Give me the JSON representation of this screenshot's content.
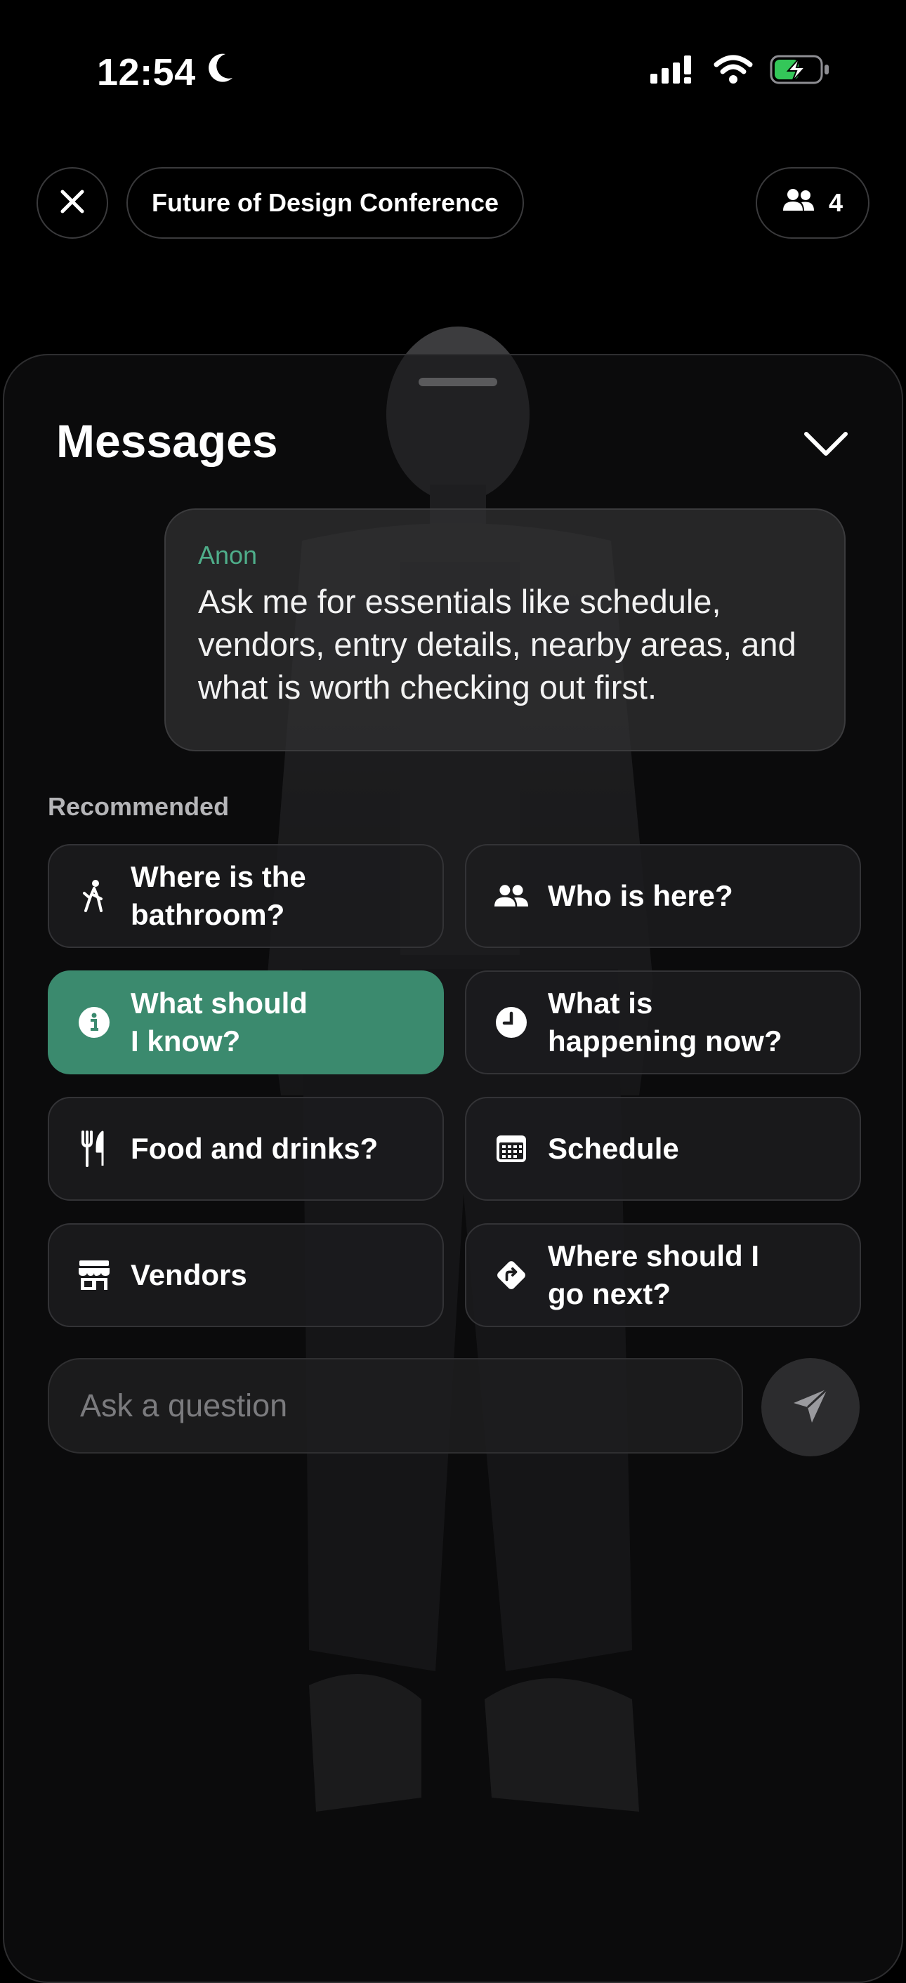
{
  "status_bar": {
    "time": "12:54"
  },
  "header": {
    "title": "Future of Design Conference",
    "people_count": "4"
  },
  "messages": {
    "title": "Messages",
    "bubble": {
      "sender": "Anon",
      "text": "Ask me for essentials like schedule, vendors, entry details, nearby areas, and what is worth checking out first."
    },
    "recommended_label": "Recommended",
    "chips": [
      {
        "label": "Where is the\nbathroom?",
        "icon": "walking-person-icon",
        "active": false
      },
      {
        "label": "Who is here?",
        "icon": "people-icon",
        "active": false
      },
      {
        "label": "What should\nI know?",
        "icon": "info-icon",
        "active": true
      },
      {
        "label": "What is\nhappening now?",
        "icon": "clock-icon",
        "active": false
      },
      {
        "label": "Food and drinks?",
        "icon": "fork-knife-icon",
        "active": false
      },
      {
        "label": "Schedule",
        "icon": "calendar-icon",
        "active": false
      },
      {
        "label": "Vendors",
        "icon": "storefront-icon",
        "active": false
      },
      {
        "label": "Where should I\ngo next?",
        "icon": "directions-icon",
        "active": false
      }
    ],
    "input": {
      "placeholder": "Ask a question"
    }
  },
  "colors": {
    "accent": "#3b8a6e",
    "sender": "#4fae8a",
    "background": "#000000"
  }
}
